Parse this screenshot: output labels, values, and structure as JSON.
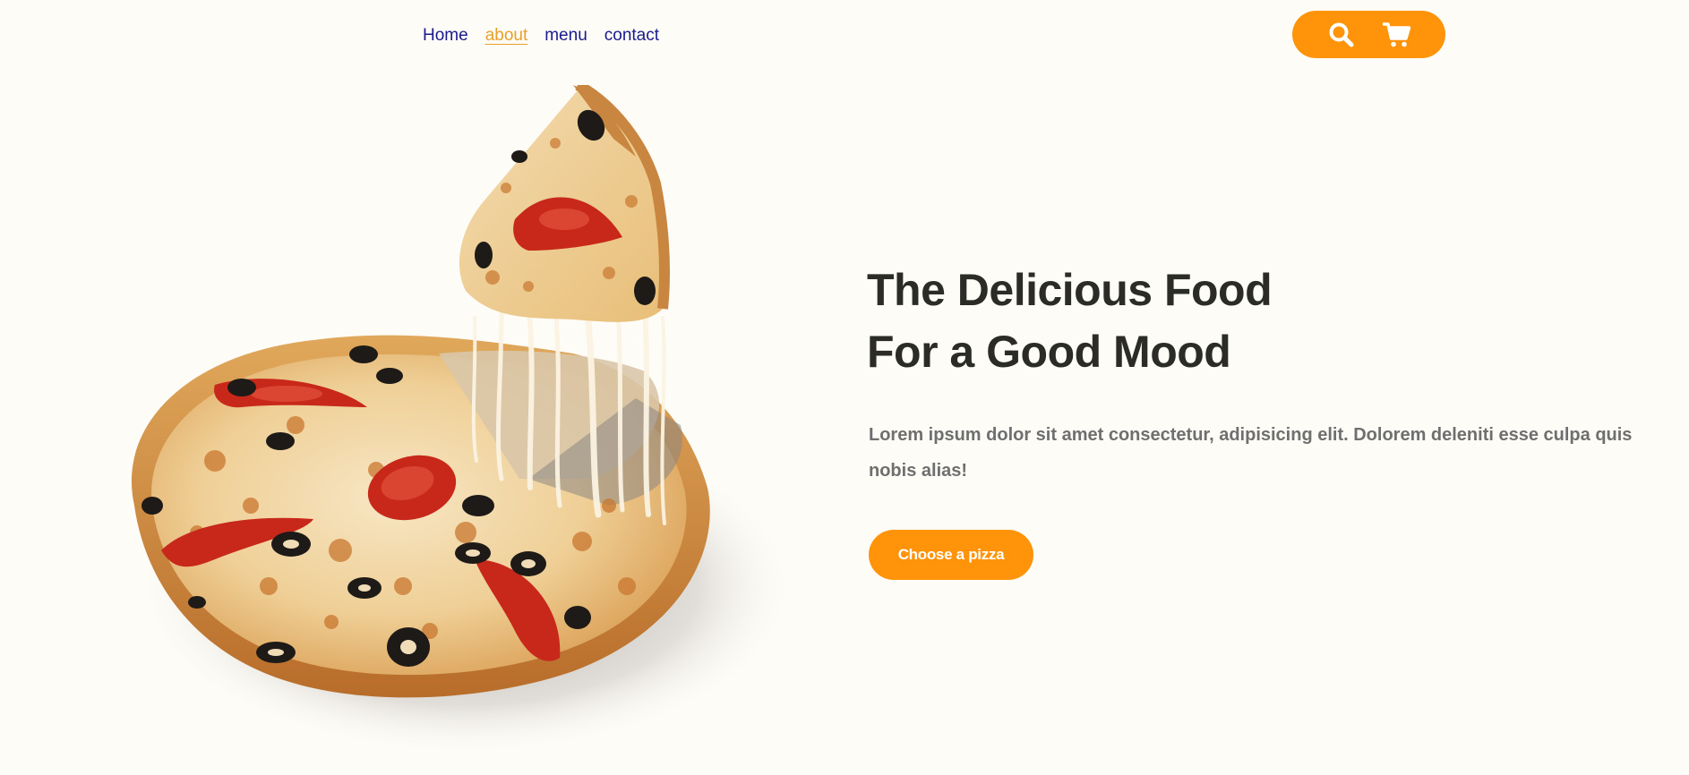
{
  "nav": {
    "items": [
      {
        "label": "Home",
        "active": false
      },
      {
        "label": "about",
        "active": true
      },
      {
        "label": "menu",
        "active": false
      },
      {
        "label": "contact",
        "active": false
      }
    ]
  },
  "actions": {
    "search_icon": "search-icon",
    "cart_icon": "cart-icon",
    "color": "#ff940a"
  },
  "hero": {
    "title_line1": "The Delicious Food",
    "title_line2": "For a Good Mood",
    "text": "Lorem ipsum dolor sit amet consectetur, adipisicing elit. Dolorem deleniti esse culpa quis nobis alias!",
    "cta_label": "Choose a pizza"
  },
  "colors": {
    "accent": "#ff940a",
    "background": "#fefcf7",
    "heading": "#2b2b28",
    "body_text": "#6f6f6f",
    "nav_link": "#1a1a8c",
    "nav_active": "#e8a02a"
  }
}
